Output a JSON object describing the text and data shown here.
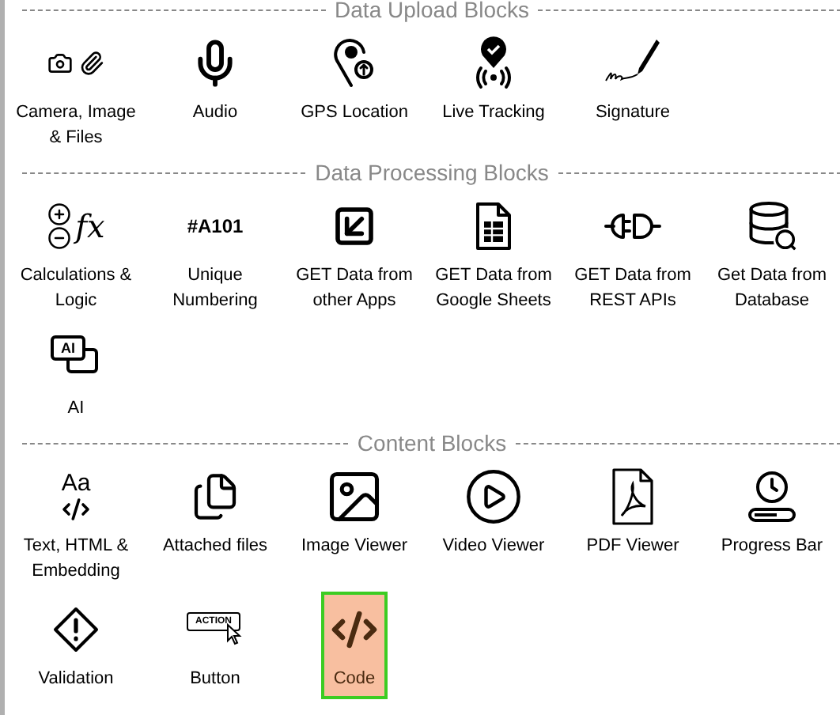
{
  "sections": [
    {
      "title": "Data Upload Blocks",
      "items": [
        {
          "kind": "camera-files",
          "label": "Camera, Image\n& Files",
          "selected": false
        },
        {
          "kind": "audio",
          "label": "Audio",
          "selected": false
        },
        {
          "kind": "gps",
          "label": "GPS Location",
          "selected": false
        },
        {
          "kind": "tracking",
          "label": "Live Tracking",
          "selected": false
        },
        {
          "kind": "signature",
          "label": "Signature",
          "selected": false
        }
      ]
    },
    {
      "title": "Data Processing Blocks",
      "items": [
        {
          "kind": "calc",
          "icon_text": "fx",
          "label": "Calculations &\nLogic",
          "selected": false
        },
        {
          "kind": "numbering",
          "icon_text": "#A101",
          "label": "Unique\nNumbering",
          "selected": false
        },
        {
          "kind": "apps",
          "label": "GET Data from\nother Apps",
          "selected": false
        },
        {
          "kind": "sheets",
          "label": "GET Data from\nGoogle Sheets",
          "selected": false
        },
        {
          "kind": "rest",
          "label": "GET Data from\nREST APIs",
          "selected": false
        },
        {
          "kind": "database",
          "label": "Get Data from\nDatabase",
          "selected": false
        },
        {
          "kind": "ai",
          "icon_text": "AI",
          "label": "AI",
          "selected": false
        }
      ]
    },
    {
      "title": "Content Blocks",
      "items": [
        {
          "kind": "text-html",
          "icon_text": "Aa",
          "label": "Text, HTML &\nEmbedding",
          "selected": false
        },
        {
          "kind": "attached",
          "label": "Attached files",
          "selected": false
        },
        {
          "kind": "image",
          "label": "Image Viewer",
          "selected": false
        },
        {
          "kind": "video",
          "label": "Video Viewer",
          "selected": false
        },
        {
          "kind": "pdf",
          "label": "PDF Viewer",
          "selected": false
        },
        {
          "kind": "progress",
          "label": "Progress Bar",
          "selected": false
        },
        {
          "kind": "validation",
          "label": "Validation",
          "selected": false
        },
        {
          "kind": "button",
          "icon_text": "ACTION",
          "label": "Button",
          "selected": false
        },
        {
          "kind": "code",
          "label": "Code",
          "selected": true
        }
      ]
    }
  ]
}
